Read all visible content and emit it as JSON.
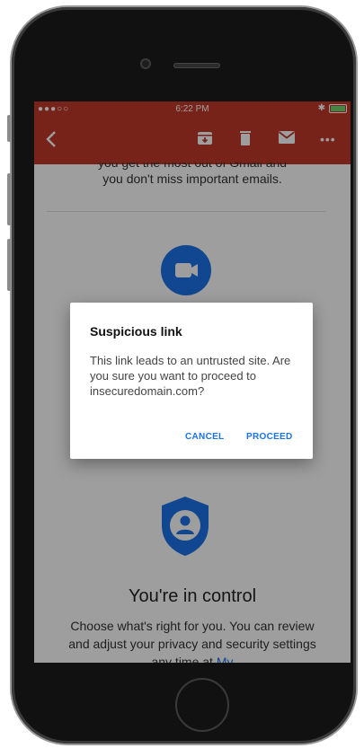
{
  "status_bar": {
    "carrier_dots": "●●●○○",
    "time": "6:22 PM"
  },
  "toolbar": {
    "back_icon": "chevron-left-icon",
    "archive_icon": "archive-icon",
    "delete_icon": "trash-icon",
    "mail_icon": "mail-icon",
    "more_icon": "more-horizontal-icon",
    "color": "#c0392b"
  },
  "email": {
    "line_partial": "you get the most out of Gmail and",
    "line_1": "you don't miss important emails.",
    "control_title": "You're in control",
    "control_body": "Choose what's right for you. You can review and adjust your privacy and security settings any time at ",
    "control_link": "My"
  },
  "dialog": {
    "title": "Suspicious link",
    "message": "This link leads to an untrusted site. Are you sure you want to proceed to insecuredomain.com?",
    "cancel_label": "CANCEL",
    "proceed_label": "PROCEED",
    "accent": "#1a73e8"
  }
}
